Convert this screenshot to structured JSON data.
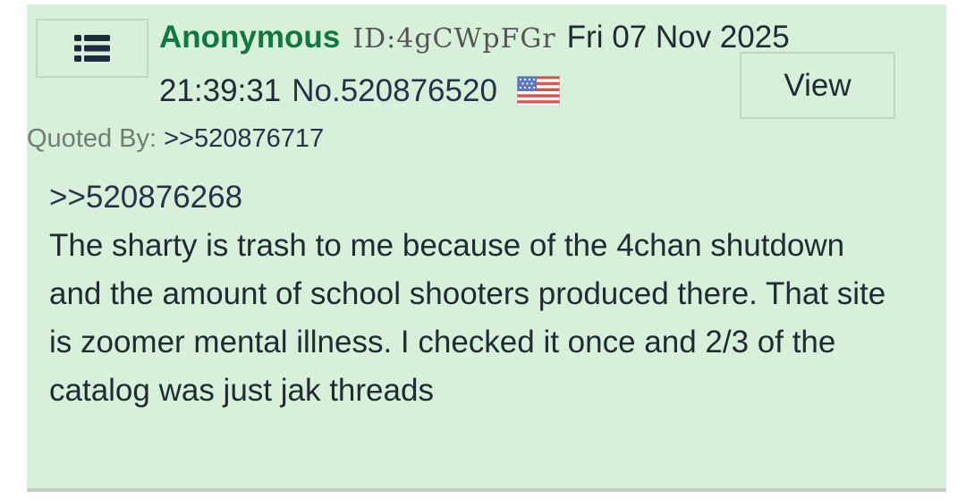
{
  "post": {
    "menu_icon": "list-icon",
    "name": "Anonymous",
    "poster_id": "ID:4gCWpFGr",
    "date": "Fri 07 Nov 2025",
    "time": "21:39:31",
    "post_no": "No.520876520",
    "flag_icon": "us-flag-icon",
    "view_label": "View",
    "quoted_by_label": "Quoted By:",
    "quoted_by_link": ">>520876717",
    "reply_to": ">>520876268",
    "body": "The sharty is trash to me because of the 4chan shutdown and the amount of school shooters produced there. That site is zoomer mental illness. I checked it once and 2/3 of the catalog was just jak threads"
  },
  "colors": {
    "post_background": "#d6f0da",
    "name": "#117743",
    "link": "#27324a",
    "text": "#222a33",
    "muted": "#717b72"
  }
}
